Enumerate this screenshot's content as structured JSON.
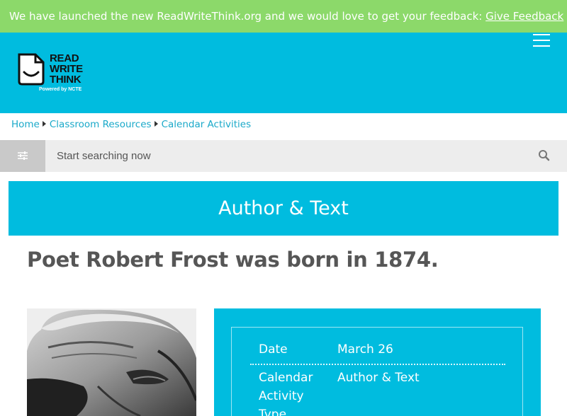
{
  "banner": {
    "message": "We have launched the new ReadWriteThink.org and we would love to get your feedback:",
    "link_label": "Give Feedback"
  },
  "logo": {
    "line1": "READ",
    "line2": "WRITE",
    "line3": "THINK",
    "tagline": "Powered by NCTE"
  },
  "breadcrumb": [
    {
      "label": "Home"
    },
    {
      "label": "Classroom Resources"
    },
    {
      "label": "Calendar Activities"
    }
  ],
  "search": {
    "placeholder": "Start searching now"
  },
  "category": {
    "label": "Author & Text"
  },
  "page": {
    "title": "Poet Robert Frost was born in 1874."
  },
  "details": {
    "date_label": "Date",
    "date_value": "March 26",
    "type_label": "Calendar Activity Type",
    "type_value": "Author & Text"
  },
  "colors": {
    "banner": "#8cd96a",
    "brand": "#00bcdf",
    "link": "#1aa9c9"
  },
  "icons": {
    "menu": "hamburger-menu-icon",
    "filter": "sliders-icon",
    "search": "magnifier-icon"
  }
}
